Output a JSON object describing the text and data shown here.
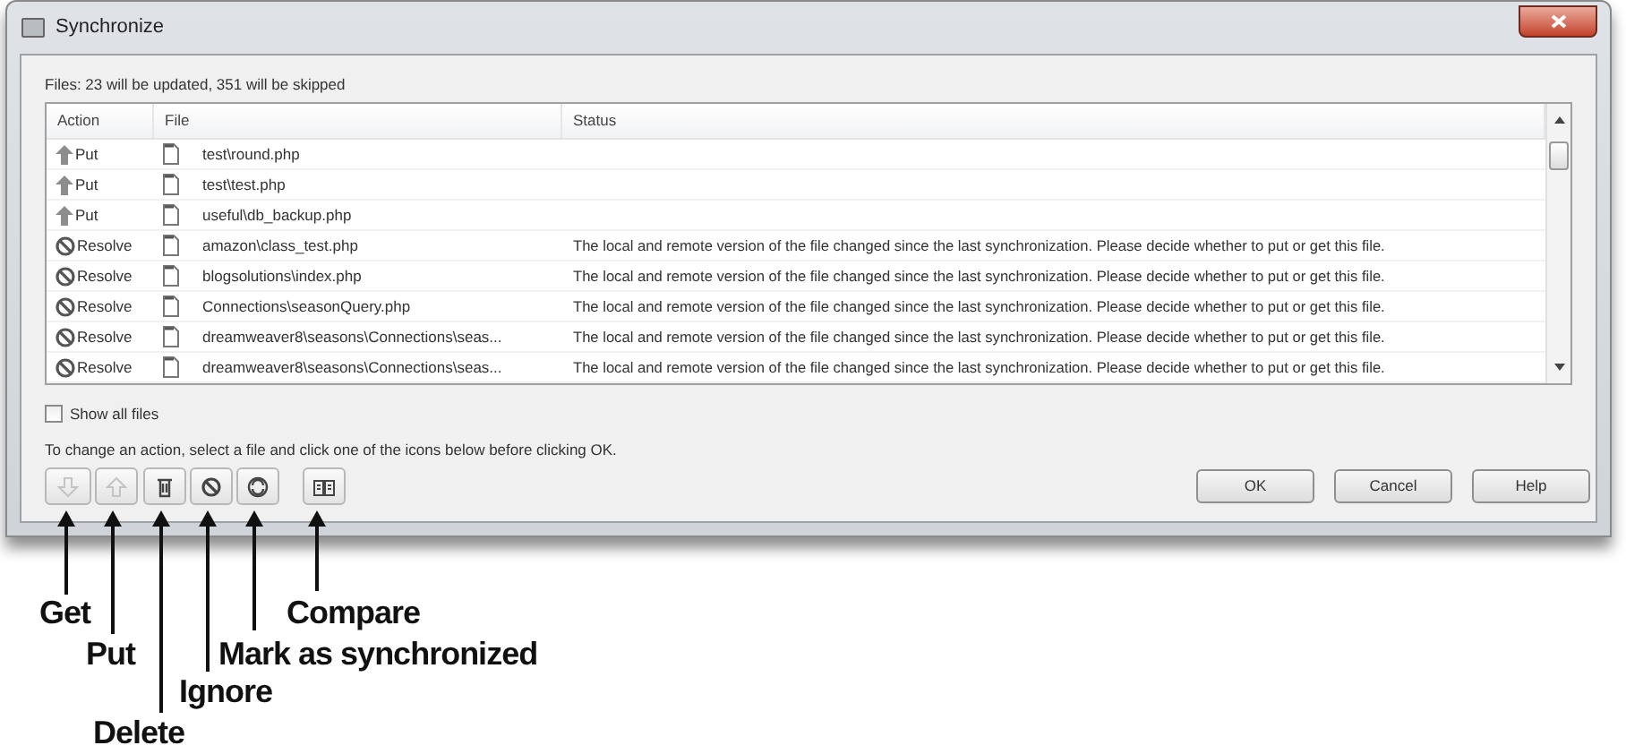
{
  "window": {
    "title": "Synchronize",
    "summary": "Files: 23 will be updated, 351 will be skipped"
  },
  "table": {
    "columns": [
      "Action",
      "File",
      "Status"
    ],
    "rows": [
      {
        "kind": "put",
        "action": "Put",
        "file": "test\\round.php"
      },
      {
        "kind": "put",
        "action": "Put",
        "file": "test\\test.php"
      },
      {
        "kind": "put",
        "action": "Put",
        "file": "useful\\db_backup.php"
      },
      {
        "kind": "resolve",
        "action": "Resolve",
        "file": "amazon\\class_test.php",
        "status": "The local and remote version of the file changed since the last synchronization. Please decide whether to put or get this file."
      },
      {
        "kind": "resolve",
        "action": "Resolve",
        "file": "blogsolutions\\index.php",
        "status": "The local and remote version of the file changed since the last synchronization. Please decide whether to put or get this file."
      },
      {
        "kind": "resolve",
        "action": "Resolve",
        "file": "Connections\\seasonQuery.php",
        "status": "The local and remote version of the file changed since the last synchronization. Please decide whether to put or get this file."
      },
      {
        "kind": "resolve",
        "action": "Resolve",
        "file": "dreamweaver8\\seasons\\Connections\\seas...",
        "status": "The local and remote version of the file changed since the last synchronization. Please decide whether to put or get this file."
      },
      {
        "kind": "resolve",
        "action": "Resolve",
        "file": "dreamweaver8\\seasons\\Connections\\seas...",
        "status": "The local and remote version of the file changed since the last synchronization. Please decide whether to put or get this file."
      }
    ]
  },
  "show_all_files": {
    "label": "Show all files",
    "checked": false
  },
  "instruction": "To change an action, select a file and click one of the icons below before clicking OK.",
  "toolbar": [
    {
      "kind": "get",
      "disabled": true
    },
    {
      "kind": "put",
      "disabled": true
    },
    {
      "kind": "delete",
      "disabled": false
    },
    {
      "kind": "ignore",
      "disabled": false
    },
    {
      "kind": "synced",
      "disabled": false
    },
    {
      "kind": "compare",
      "disabled": false
    }
  ],
  "callouts": [
    {
      "kind": "get",
      "label": "Get"
    },
    {
      "kind": "compare",
      "label": "Compare"
    },
    {
      "kind": "put",
      "label": "Put"
    },
    {
      "kind": "synced",
      "label": "Mark as synchronized"
    },
    {
      "kind": "ignore",
      "label": "Ignore"
    },
    {
      "kind": "delete",
      "label": "Delete"
    }
  ],
  "buttons": [
    "OK",
    "Cancel",
    "Help"
  ]
}
